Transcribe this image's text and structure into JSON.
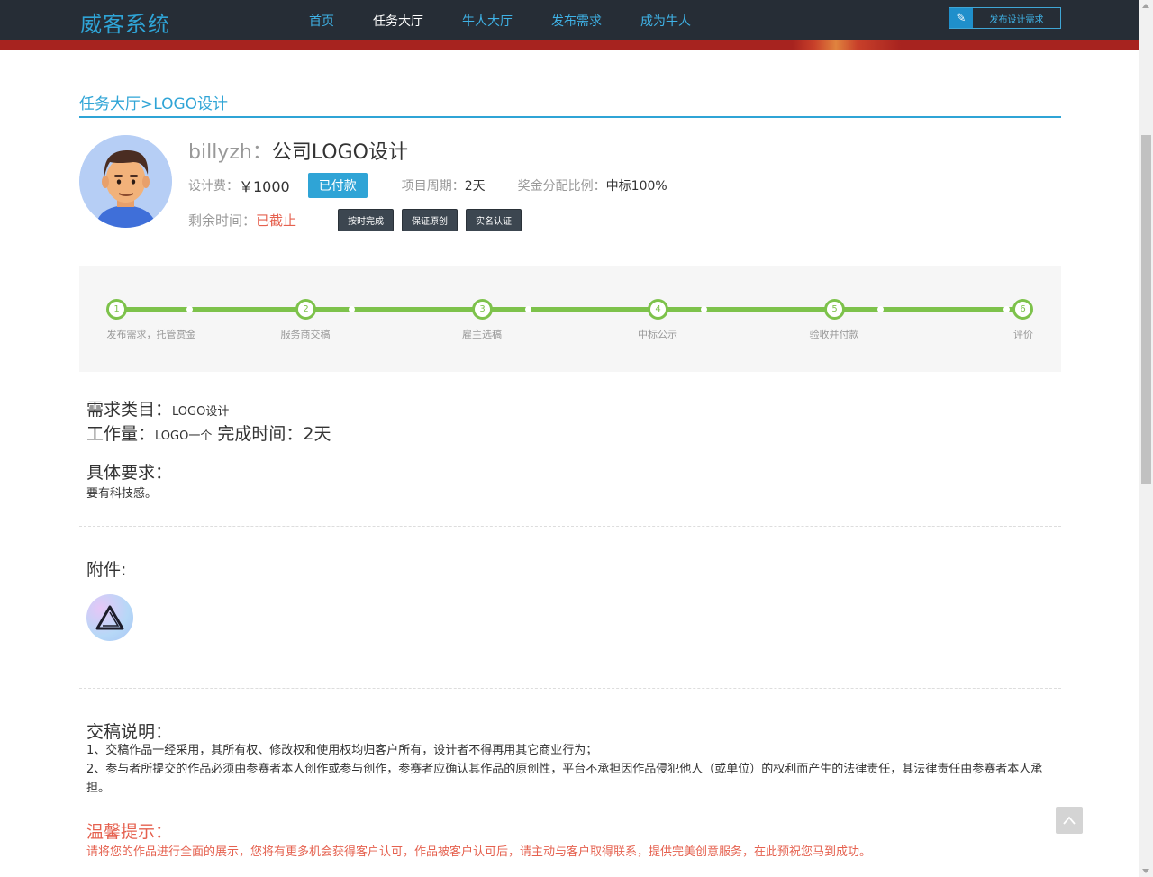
{
  "nav": {
    "logo": "威客系统",
    "items": [
      "首页",
      "任务大厅",
      "牛人大厅",
      "发布需求",
      "成为牛人"
    ],
    "active_index": 1,
    "publish_button": "发布设计需求"
  },
  "breadcrumb": "任务大厅>LOGO设计",
  "task": {
    "user": "billyzh",
    "separator": "：",
    "title": "公司LOGO设计",
    "fee_label": "设计费：",
    "fee_value": "￥1000",
    "paid_badge": "已付款",
    "period_label": "项目周期：",
    "period_value": "2天",
    "ratio_label": "奖金分配比例：",
    "ratio_value": "中标100%",
    "remaining_label": "剩余时间：",
    "remaining_value": "已截止",
    "tags": [
      "按时完成",
      "保证原创",
      "实名认证"
    ]
  },
  "progress": {
    "steps": [
      {
        "num": "1",
        "label": "发布需求，托管赏金"
      },
      {
        "num": "2",
        "label": "服务商交稿"
      },
      {
        "num": "3",
        "label": "雇主选稿"
      },
      {
        "num": "4",
        "label": "中标公示"
      },
      {
        "num": "5",
        "label": "验收并付款"
      },
      {
        "num": "6",
        "label": "评价"
      }
    ]
  },
  "details": {
    "category_label": "需求类目：",
    "category_value": "LOGO设计",
    "workload_label": "工作量：",
    "workload_value": "LOGO一个",
    "finish_label": "完成时间：",
    "finish_value": "2天",
    "requirement_label": "具体要求：",
    "requirement_value": "要有科技感。",
    "attachment_label": "附件:"
  },
  "notice": {
    "title": "交稿说明：",
    "lines": [
      "1、交稿作品一经采用，其所有权、修改权和使用权均归客户所有，设计者不得再用其它商业行为；",
      "2、参与者所提交的作品必须由参赛者本人创作或参与创作，参赛者应确认其作品的原创性，平台不承担因作品侵犯他人（或单位）的权利而产生的法律责任，其法律责任由参赛者本人承担。"
    ]
  },
  "tips": {
    "title": "温馨提示：",
    "body": "请将您的作品进行全面的展示，您将有更多机会获得客户认可，作品被客户认可后，请主动与客户取得联系，提供完美创意服务，在此预祝您马到成功。"
  },
  "colors": {
    "accent": "#2fa4d6",
    "nav_bg": "#262d36",
    "progress_green": "#7dc24b",
    "warning_red": "#e5614f"
  }
}
